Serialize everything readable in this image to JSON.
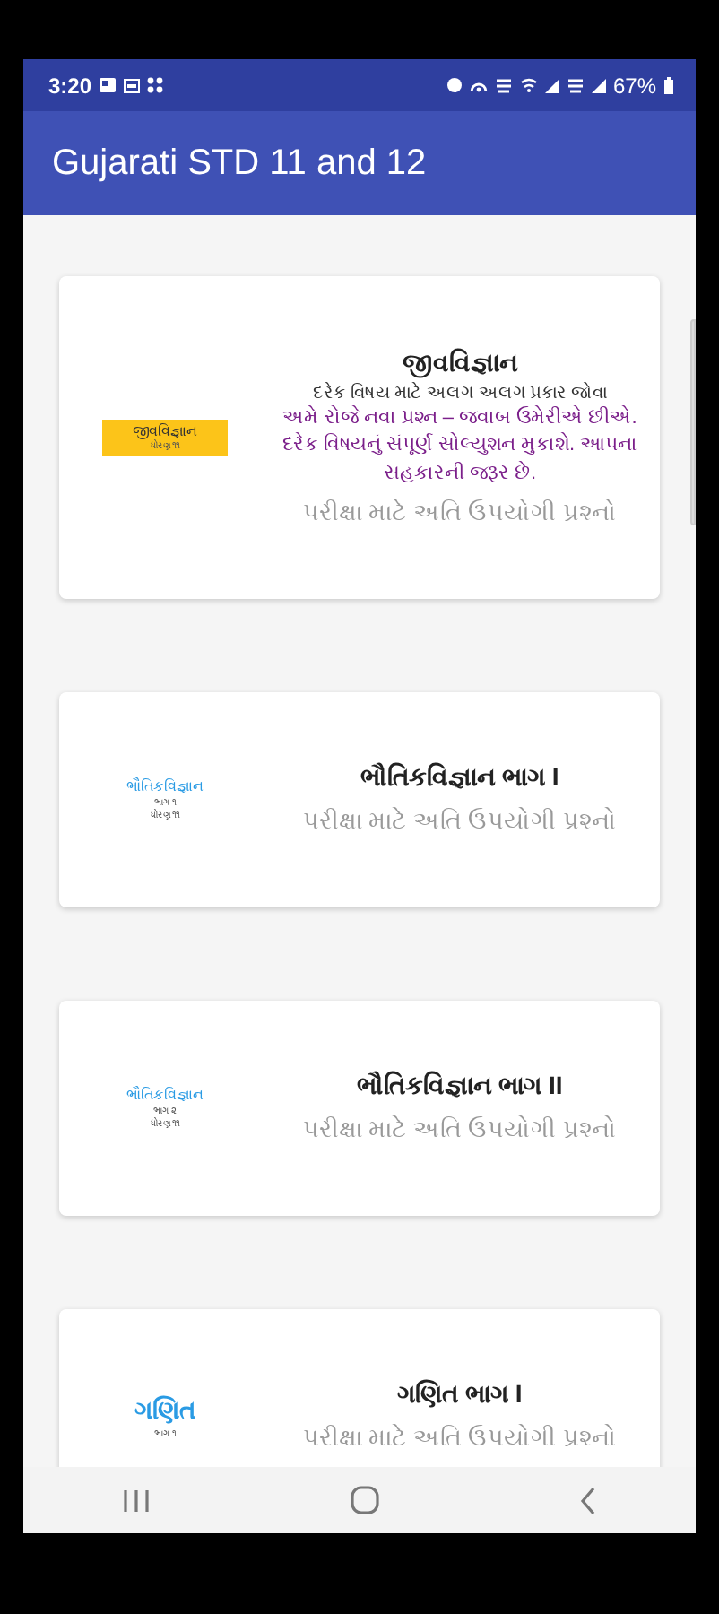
{
  "status_bar": {
    "time": "3:20",
    "battery": "67%"
  },
  "app_bar": {
    "title": "Gujarati STD 11 and 12"
  },
  "cards": [
    {
      "thumb": {
        "kind": "banner",
        "title": "જીવવિજ્ઞાન",
        "lines": [
          "ધોરણ ૧૧"
        ]
      },
      "title": "જીવવિજ્ઞાન",
      "note": "દરેક વિષય માટે અલગ અલગ પ્રકાર જોવા",
      "notice": "અમે રોજે નવા પ્રશ્ન – જવાબ ઉમેરીએ છીએ. દરેક વિષયનું સંપૂર્ણ સોલ્યુશન મુકાશે. આપના સહકારની જરૂર છે.",
      "subtitle": "પરીક્ષા માટે અતિ ઉપયોગી પ્રશ્નો"
    },
    {
      "thumb": {
        "kind": "small",
        "title": "ભૌતિકવિજ્ઞાન",
        "lines": [
          "ભાગ ૧",
          "ધોરણ ૧૧"
        ]
      },
      "title": "ભૌતિકવિજ્ઞાન ભાગ I",
      "subtitle": "પરીક્ષા માટે અતિ ઉપયોગી પ્રશ્નો"
    },
    {
      "thumb": {
        "kind": "small",
        "title": "ભૌતિકવિજ્ઞાન",
        "lines": [
          "ભાગ ૨",
          "ધોરણ ૧૧"
        ]
      },
      "title": "ભૌતિકવિજ્ઞાન ભાગ II",
      "subtitle": "પરીક્ષા માટે અતિ ઉપયોગી પ્રશ્નો"
    },
    {
      "thumb": {
        "kind": "large",
        "title": "ગણિત",
        "lines": [
          "ભાગ ૧"
        ]
      },
      "title": "ગણિત ભાગ I",
      "subtitle": "પરીક્ષા માટે અતિ ઉપયોગી પ્રશ્નો"
    }
  ]
}
